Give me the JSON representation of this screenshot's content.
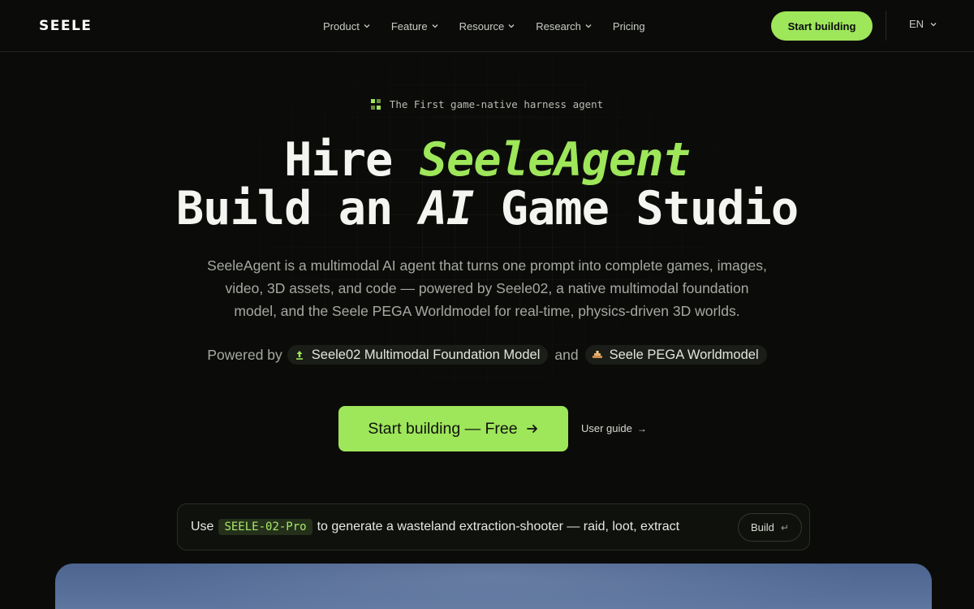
{
  "nav": {
    "logo": "SEELE",
    "items": [
      {
        "label": "Product",
        "has_dropdown": true
      },
      {
        "label": "Feature",
        "has_dropdown": true
      },
      {
        "label": "Resource",
        "has_dropdown": true
      },
      {
        "label": "Research",
        "has_dropdown": true
      },
      {
        "label": "Pricing",
        "has_dropdown": false
      }
    ],
    "cta_label": "Start building",
    "language": "EN"
  },
  "hero": {
    "eyebrow": "The First game-native harness agent",
    "title_line1_prefix": "Hire",
    "title_line1_accent": "SeeleAgent",
    "title_line2_a": "Build an",
    "title_line2_italic": "AI",
    "title_line2_b": "Game Studio",
    "description": "SeeleAgent is a multimodal AI agent that turns one prompt into complete games, images, video, 3D assets, and code — powered by Seele02, a native multimodal foundation model, and the Seele PEGA Worldmodel for real-time, physics-driven 3D worlds.",
    "powered_by_label": "Powered by",
    "powered_model_1": "Seele02 Multimodal Foundation Model",
    "powered_join": "and",
    "powered_model_2": "Seele PEGA Worldmodel",
    "cta_label": "Start building — Free",
    "guide_label": "User guide",
    "guide_arrow": "→"
  },
  "prompt": {
    "prefix": "Use",
    "model": "SEELE-02-Pro",
    "text": "to generate a wasteland extraction-shooter — raid, loot, extract",
    "build_label": "Build",
    "enter_glyph": "↵"
  },
  "colors": {
    "accent": "#9ee65a",
    "background": "#0b0c0a"
  }
}
